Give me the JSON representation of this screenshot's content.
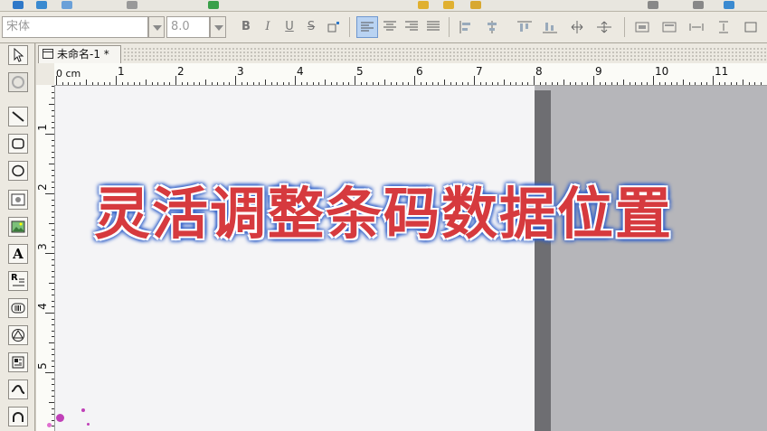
{
  "toolbar": {
    "font_name_value": "宋体",
    "font_size_value": "8.0",
    "bold_label": "B",
    "italic_label": "I",
    "underline_label": "U",
    "strike_label": "S",
    "align_left_icon": "align-left-icon",
    "align_center_icon": "align-center-icon",
    "align_right_icon": "align-right-icon",
    "align_justify_icon": "align-justify-icon"
  },
  "left_tools": [
    "pointer-icon",
    "pan-icon",
    "line-icon",
    "rounded-rectangle-icon",
    "ellipse-icon",
    "image-icon",
    "image-icon",
    "text-icon",
    "rich-text-icon",
    "barcode-icon",
    "qrcode-icon",
    "database-icon",
    "curve-icon",
    "arc-icon"
  ],
  "left_tool_labels": {
    "text": "A",
    "richtext": "R"
  },
  "document": {
    "tab_title": "未命名-1 *"
  },
  "ruler": {
    "unit_label": "0 cm",
    "h_ticks": [
      "1",
      "2",
      "3",
      "4",
      "5",
      "6",
      "7",
      "8",
      "9",
      "10",
      "11"
    ],
    "v_ticks": [
      "1",
      "2",
      "3",
      "4",
      "5"
    ]
  },
  "overlay": {
    "caption": "灵活调整条码数据位置",
    "text_color": "#d63a3e",
    "outline_color": "#2f5fc8"
  },
  "colors": {
    "selected_button_bg": "#b9d3f2",
    "page_bg": "#f4f4f6",
    "canvas_bg": "#b6b6ba"
  }
}
